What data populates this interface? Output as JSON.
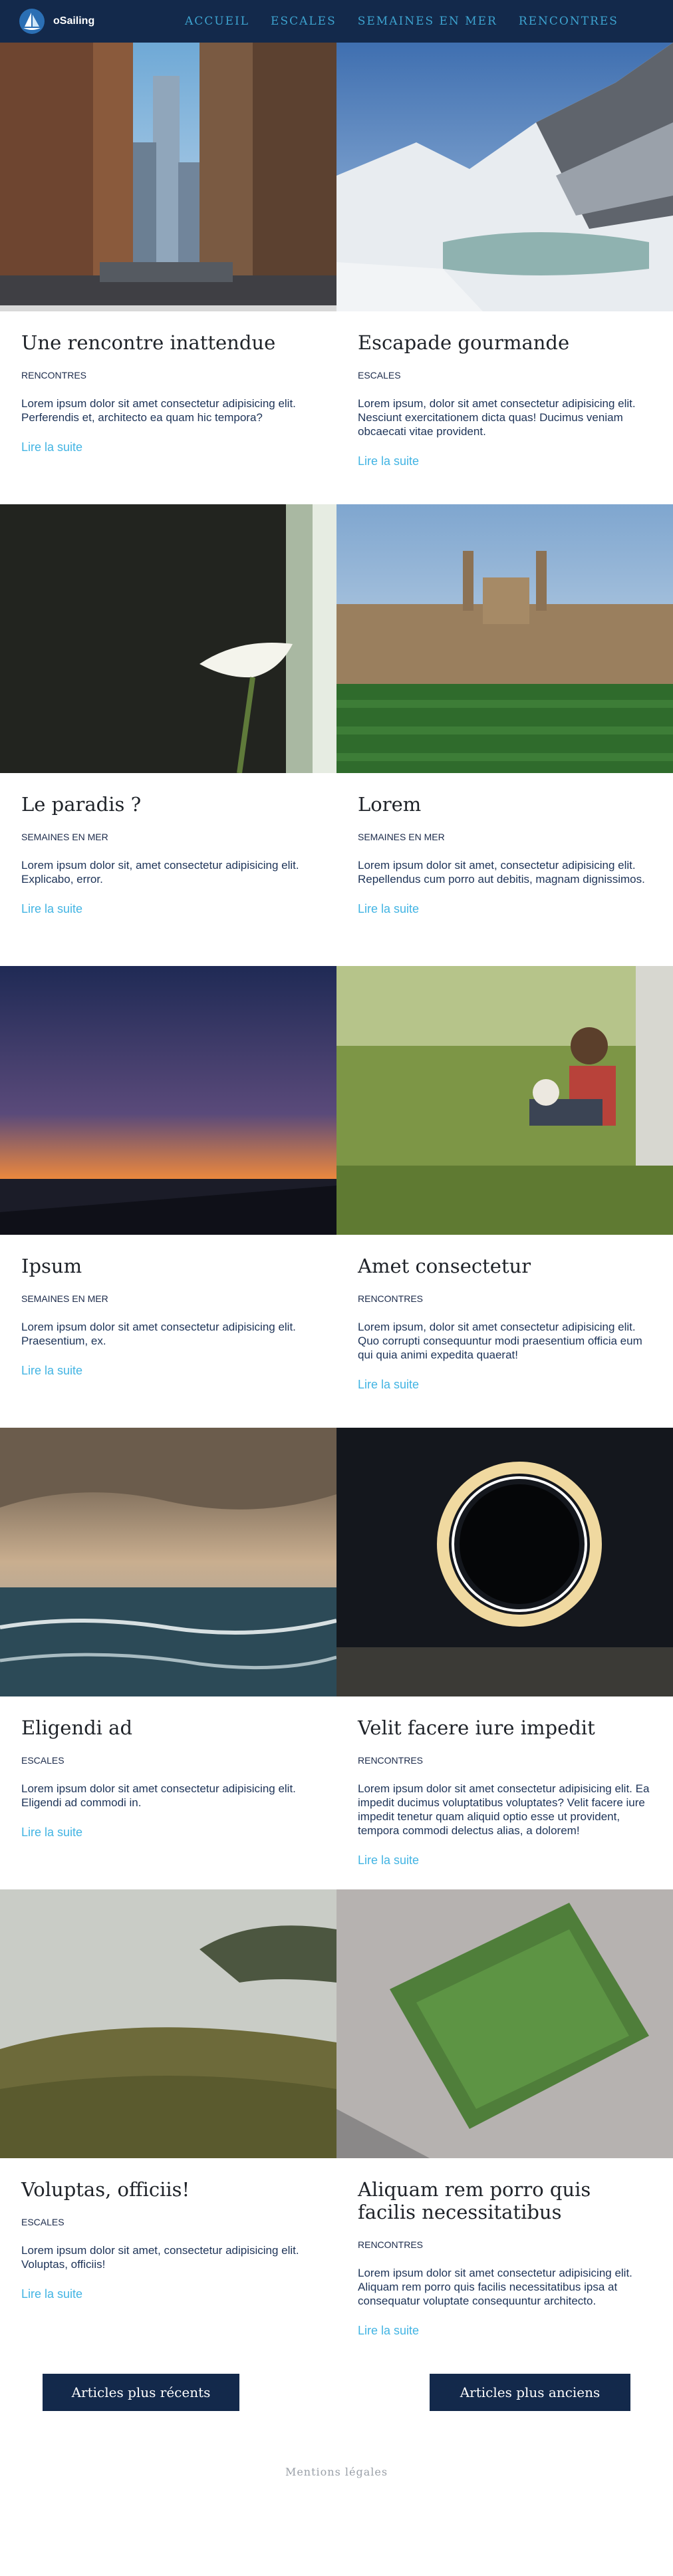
{
  "header": {
    "brand": "oSailing",
    "nav": [
      {
        "label": "ACCUEIL"
      },
      {
        "label": "ESCALES"
      },
      {
        "label": "SEMAINES EN MER"
      },
      {
        "label": "RENCONTRES"
      }
    ]
  },
  "articles": [
    {
      "title": "Une rencontre inattendue",
      "category": "RENCONTRES",
      "excerpt": "Lorem ipsum dolor sit amet consectetur adipisicing elit. Perferendis et, architecto ea quam hic tempora?",
      "link": "Lire la suite",
      "image": "city-street-photo"
    },
    {
      "title": "Escapade gourmande",
      "category": "ESCALES",
      "excerpt": "Lorem ipsum, dolor sit amet consectetur adipisicing elit. Nesciunt exercitationem dicta quas! Ducimus veniam obcaecati vitae provident.",
      "link": "Lire la suite",
      "image": "snowy-mountain-lake-photo"
    },
    {
      "title": "Le paradis ?",
      "category": "SEMAINES EN MER",
      "excerpt": "Lorem ipsum dolor sit, amet consectetur adipisicing elit. Explicabo, error.",
      "link": "Lire la suite",
      "image": "calla-lily-photo"
    },
    {
      "title": "Lorem",
      "category": "SEMAINES EN MER",
      "excerpt": "Lorem ipsum dolor sit amet, consectetur adipisicing elit. Repellendus cum porro aut debitis, magnam dignissimos.",
      "link": "Lire la suite",
      "image": "college-building-photo"
    },
    {
      "title": "Ipsum",
      "category": "SEMAINES EN MER",
      "excerpt": "Lorem ipsum dolor sit amet consectetur adipisicing elit. Praesentium, ex.",
      "link": "Lire la suite",
      "image": "sunset-pier-photo"
    },
    {
      "title": "Amet consectetur",
      "category": "RENCONTRES",
      "excerpt": "Lorem ipsum, dolor sit amet consectetur adipisicing elit. Quo corrupti consequuntur modi praesentium officia eum qui quia animi expedita quaerat!",
      "link": "Lire la suite",
      "image": "reading-in-grass-photo"
    },
    {
      "title": "Eligendi ad",
      "category": "ESCALES",
      "excerpt": "Lorem ipsum dolor sit amet consectetur adipisicing elit. Eligendi ad commodi in.",
      "link": "Lire la suite",
      "image": "stormy-sea-photo"
    },
    {
      "title": "Velit facere iure impedit",
      "category": "RENCONTRES",
      "excerpt": "Lorem ipsum dolor sit amet consectetur adipisicing elit. Ea impedit ducimus voluptatibus voluptates? Velit facere iure impedit tenetur quam aliquid optio esse ut provident, tempora commodi delectus alias, a dolorem!",
      "link": "Lire la suite",
      "image": "light-ring-photo"
    },
    {
      "title": "Voluptas, officiis!",
      "category": "ESCALES",
      "excerpt": "Lorem ipsum dolor sit amet, consectetur adipisicing elit. Voluptas, officiis!",
      "link": "Lire la suite",
      "image": "foggy-hill-photo"
    },
    {
      "title": "Aliquam rem porro quis facilis necessitatibus",
      "category": "RENCONTRES",
      "excerpt": "Lorem ipsum dolor sit amet consectetur adipisicing elit. Aliquam rem porro quis facilis necessitatibus ipsa at consequatur voluptate consequuntur architecto.",
      "link": "Lire la suite",
      "image": "aerial-football-field-photo"
    }
  ],
  "pagination": {
    "newer": "Articles plus récents",
    "older": "Articles plus anciens"
  },
  "footer": {
    "legal": "Mentions légales"
  }
}
